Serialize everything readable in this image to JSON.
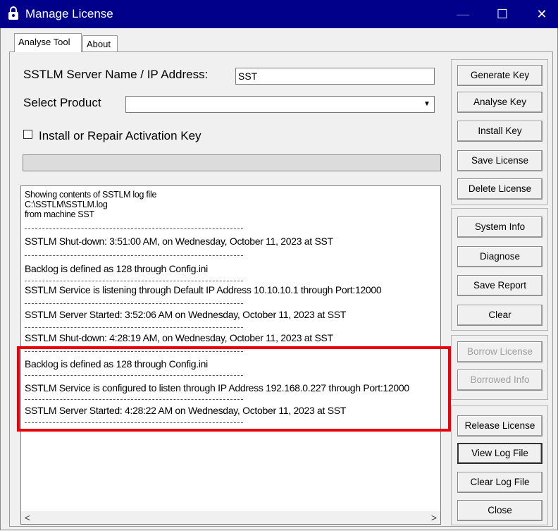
{
  "window": {
    "title": "Manage License",
    "app_icon": "padlock-icon",
    "minimize": "—",
    "maximize": "☐",
    "close": "✕"
  },
  "tabs": [
    {
      "label": "Analyse Tool",
      "active": true
    },
    {
      "label": "About",
      "active": false
    }
  ],
  "form": {
    "server_label": "SSTLM Server Name / IP Address:",
    "server_value": "SST",
    "product_label": "Select Product",
    "product_value": "",
    "install_checkbox_label": "Install or Repair Activation Key",
    "install_checked": false
  },
  "log": {
    "header": [
      "Showing contents of SSTLM log file",
      "C:\\SSTLM\\SSTLM.log",
      "from machine SST"
    ],
    "entries": [
      "SSTLM Shut-down: 3:51:00 AM, on Wednesday, October 11, 2023 at SST",
      "Backlog is defined as 128 through Config.ini",
      "SSTLM Service is listening through Default IP Address 10.10.10.1 through Port:12000",
      "SSTLM Server Started: 3:52:06 AM on Wednesday, October 11, 2023 at SST",
      "SSTLM Shut-down: 4:28:19 AM, on Wednesday, October 11, 2023 at SST",
      "Backlog is defined as 128 through Config.ini",
      "SSTLM Service is configured to listen through IP Address 192.168.0.227 through Port:12000",
      "SSTLM Server Started: 4:28:22 AM on Wednesday, October 11, 2023 at SST"
    ],
    "separator": "--------------------------------------------------------------------------------"
  },
  "buttons": {
    "generate_key": "Generate Key",
    "analyse_key": "Analyse Key",
    "install_key": "Install Key",
    "save_license": "Save License",
    "delete_license": "Delete License",
    "system_info": "System Info",
    "diagnose": "Diagnose",
    "save_report": "Save Report",
    "clear": "Clear",
    "borrow_license": "Borrow License",
    "borrowed_info": "Borrowed Info",
    "release_license": "Release License",
    "view_log_file": "View Log File",
    "clear_log_file": "Clear Log File",
    "close": "Close"
  },
  "scroll": {
    "left": "<",
    "right": ">"
  },
  "colors": {
    "titlebar": "#00008b",
    "highlight": "#e8000d",
    "window_bg": "#f0f0f0"
  }
}
